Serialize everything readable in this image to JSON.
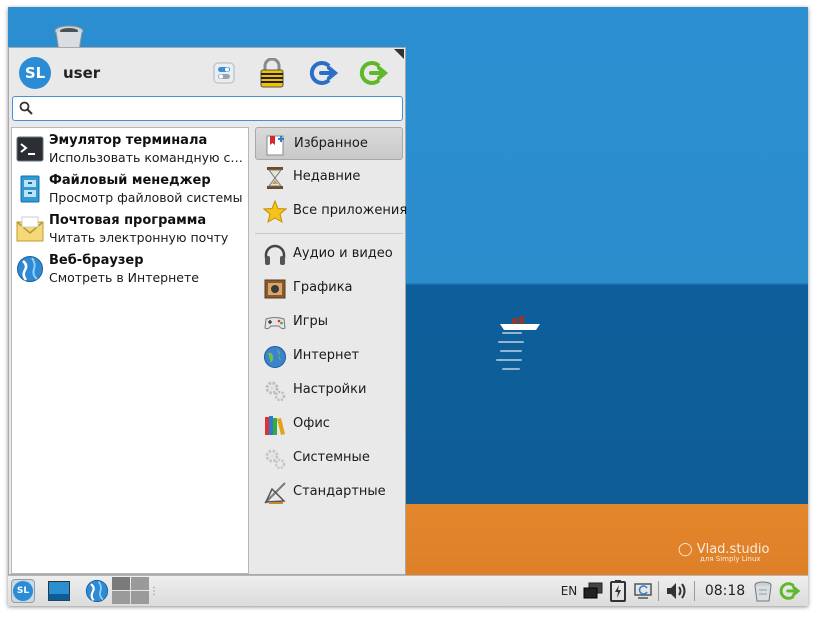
{
  "menu": {
    "user": {
      "avatar_text": "SL",
      "name": "user"
    },
    "actions": [
      {
        "name": "settings-toggle-icon"
      },
      {
        "name": "lock-screen-icon"
      },
      {
        "name": "logout-icon"
      },
      {
        "name": "shutdown-icon"
      }
    ],
    "search": {
      "value": "",
      "placeholder": ""
    },
    "favorites": [
      {
        "title": "Эмулятор терминала",
        "description": "Использовать командную ст...",
        "icon": "terminal-icon"
      },
      {
        "title": "Файловый менеджер",
        "description": "Просмотр файловой системы",
        "icon": "file-manager-icon"
      },
      {
        "title": "Почтовая программа",
        "description": "Читать электронную почту",
        "icon": "mail-icon"
      },
      {
        "title": "Веб-браузер",
        "description": "Смотреть в Интернете",
        "icon": "web-browser-icon"
      }
    ],
    "categories_top": [
      {
        "label": "Избранное",
        "icon": "favorites-icon",
        "selected": true
      },
      {
        "label": "Недавние",
        "icon": "hourglass-icon"
      },
      {
        "label": "Все приложения",
        "icon": "star-icon"
      }
    ],
    "categories": [
      {
        "label": "Аудио и видео",
        "icon": "headphones-icon"
      },
      {
        "label": "Графика",
        "icon": "graphics-icon"
      },
      {
        "label": "Игры",
        "icon": "gamepad-icon"
      },
      {
        "label": "Интернет",
        "icon": "globe-icon"
      },
      {
        "label": "Настройки",
        "icon": "gears-icon"
      },
      {
        "label": "Офис",
        "icon": "books-icon"
      },
      {
        "label": "Системные",
        "icon": "system-gears-icon"
      },
      {
        "label": "Стандартные",
        "icon": "drafting-tools-icon"
      }
    ]
  },
  "desktop": {
    "watermark_title": "Vlad.studio",
    "watermark_subtitle": "для Simply Linux"
  },
  "taskbar": {
    "start_label": "SL",
    "language": "EN",
    "clock": "08:18"
  },
  "colors": {
    "accent": "#4a90d9",
    "sky": "#2a8ed0",
    "sea": "#0e5d97",
    "sand": "#e4862c",
    "exit_green": "#5fb82a"
  }
}
